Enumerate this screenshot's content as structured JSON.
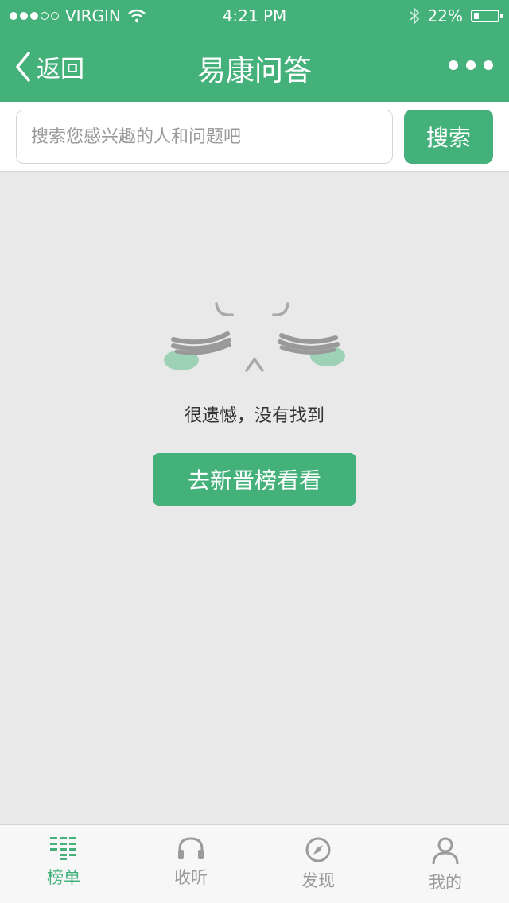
{
  "status_bar": {
    "carrier": "VIRGIN",
    "time": "4:21 PM",
    "battery": "22%",
    "battery_level": 0.22
  },
  "nav": {
    "back_label": "返回",
    "title": "易康问答"
  },
  "search": {
    "placeholder": "搜索您感兴趣的人和问题吧",
    "button_label": "搜索"
  },
  "empty_state": {
    "message": "很遗憾，没有找到",
    "action_label": "去新晋榜看看"
  },
  "tabbar": {
    "items": [
      {
        "label": "榜单",
        "icon": "list-icon",
        "active": true
      },
      {
        "label": "收听",
        "icon": "headphones-icon",
        "active": false
      },
      {
        "label": "发现",
        "icon": "compass-icon",
        "active": false
      },
      {
        "label": "我的",
        "icon": "user-icon",
        "active": false
      }
    ]
  },
  "colors": {
    "accent": "#44b17b",
    "background": "#e9e9e9",
    "inactive": "#9b9b9b"
  }
}
